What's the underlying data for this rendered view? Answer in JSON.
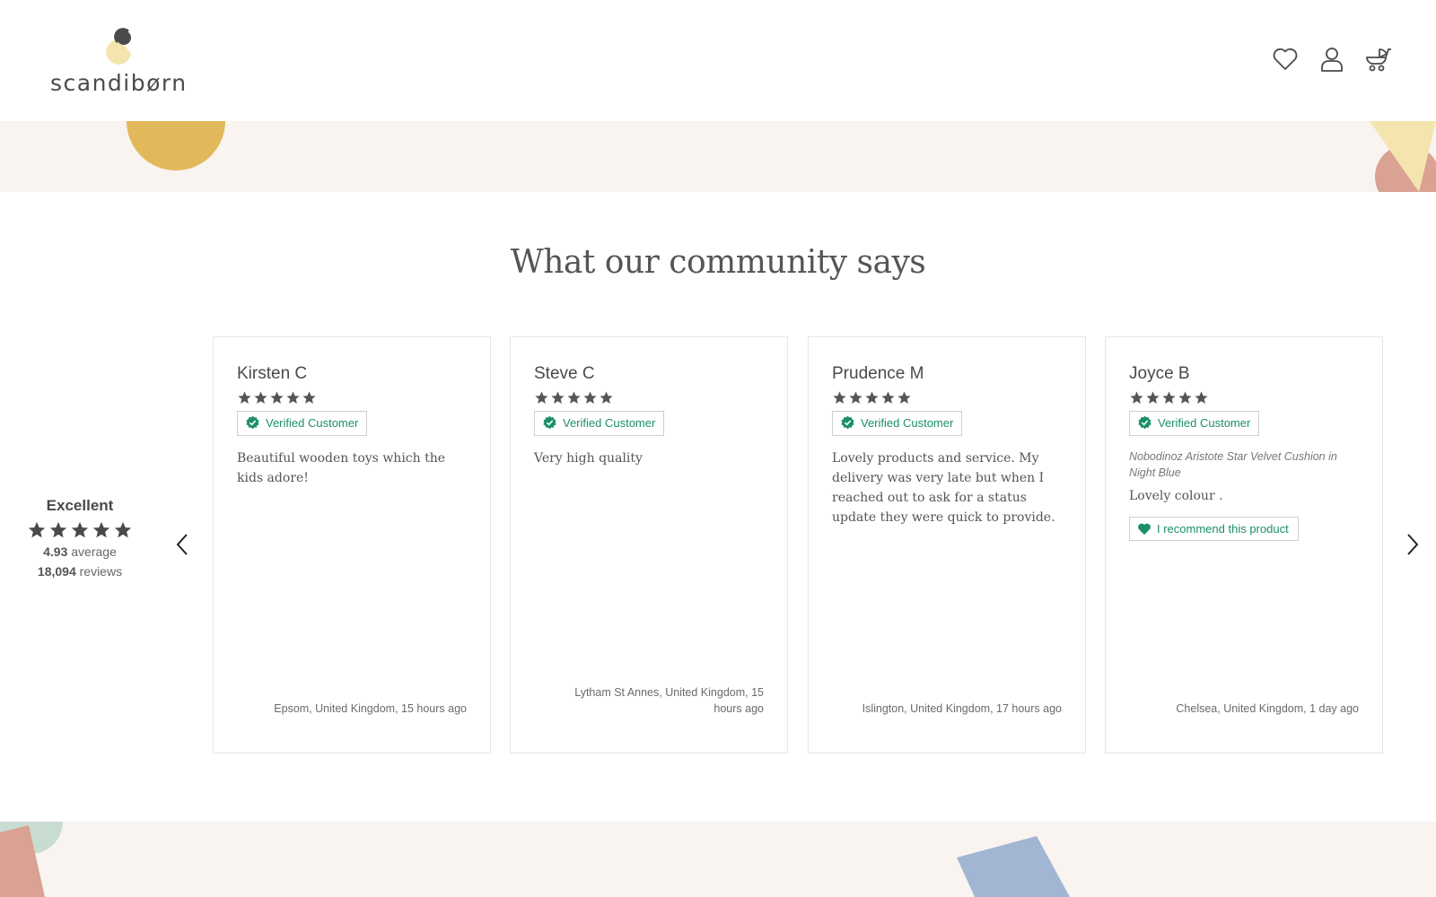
{
  "header": {
    "logo_text": "scandibørn",
    "icons": [
      "heart-icon",
      "user-icon",
      "cart-icon"
    ]
  },
  "section": {
    "title": "What our community says"
  },
  "summary": {
    "label": "Excellent",
    "stars": 5,
    "average_value": "4.93",
    "average_label": "average",
    "reviews_value": "18,094",
    "reviews_label": "reviews"
  },
  "reviews": [
    {
      "name": "Kirsten C",
      "stars": 5,
      "badge": "Verified Customer",
      "product": "",
      "body": "Beautiful wooden toys which the kids adore!",
      "recommend": "",
      "location": "Epsom, United Kingdom, 15 hours ago"
    },
    {
      "name": "Steve C",
      "stars": 5,
      "badge": "Verified Customer",
      "product": "",
      "body": "Very high quality",
      "recommend": "",
      "location": "Lytham St Annes, United Kingdom, 15 hours ago"
    },
    {
      "name": "Prudence M",
      "stars": 5,
      "badge": "Verified Customer",
      "product": "",
      "body": "Lovely products and service. My delivery was very late but when I reached out to ask for a status update they were quick to provide.",
      "recommend": "",
      "location": "Islington, United Kingdom, 17 hours ago"
    },
    {
      "name": "Joyce B",
      "stars": 5,
      "badge": "Verified Customer",
      "product": "Nobodinoz Aristote Star Velvet Cushion in Night Blue",
      "body": "Lovely colour .",
      "recommend": "I recommend this product",
      "location": "Chelsea, United Kingdom, 1 day ago"
    }
  ],
  "colors": {
    "verified_green": "#1a9064",
    "band_bg": "#f9f4f0",
    "text": "#4a4a4a",
    "deco_mustard": "#e2b95a",
    "deco_yellow": "#f4e5ae",
    "deco_rose": "#d9a293",
    "deco_sage": "#c9dcd2",
    "deco_blue": "#a2b6d3"
  }
}
